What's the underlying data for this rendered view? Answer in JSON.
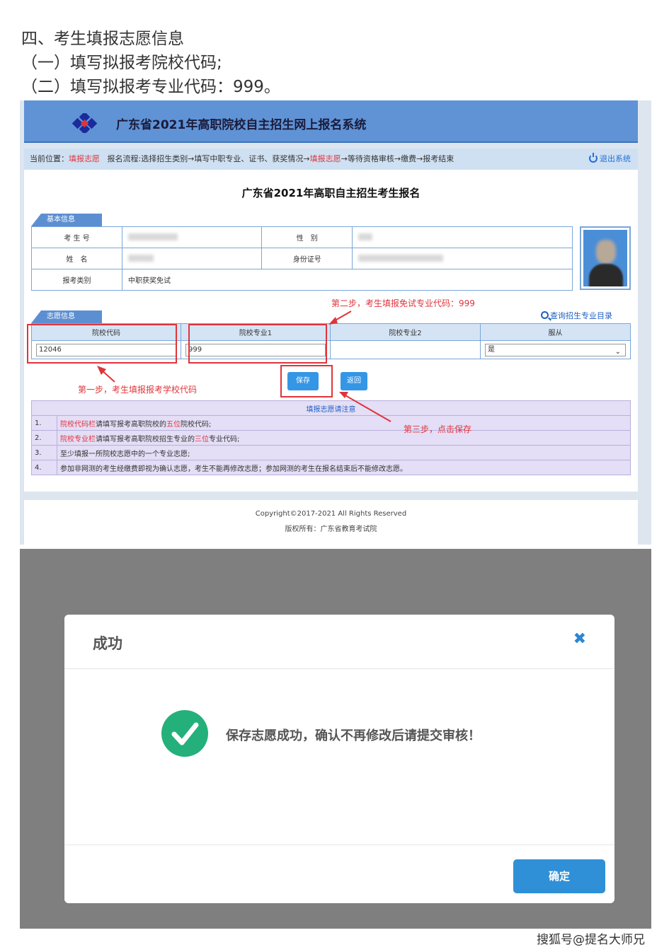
{
  "intro": {
    "heading": "四、考生填报志愿信息",
    "step1": "（一）填写拟报考院校代码;",
    "step2": "（二）填写拟报考专业代码：999。"
  },
  "app": {
    "title": "广东省2021年高职院校自主招生网上报名系统",
    "brand_colors": {
      "banner": "#5f93d6",
      "crumb": "#cfe0f2",
      "accent_red": "#e0343b",
      "button_blue": "#3596e6"
    }
  },
  "breadcrumb": {
    "current_label": "当前位置：",
    "current_page": "填报志愿",
    "flow_label": "报名流程:",
    "flow_steps_before": "选择招生类别→填写中职专业、证书、获奖情况→",
    "flow_current": "填报志愿",
    "flow_steps_after": "→等待资格审核→缴费→报考结束",
    "logout": "退出系统"
  },
  "form": {
    "title": "广东省2021年高职自主招生考生报名",
    "basic_section": "基本信息",
    "labels": {
      "exam_no": "考 生 号",
      "gender": "性　别",
      "name": "姓　名",
      "id_no": "身份证号",
      "category": "报考类别"
    },
    "category_value": "中职获奖免试",
    "wish_section": "志愿信息",
    "query_link": "查询招生专业目录",
    "columns": [
      "院校代码",
      "院校专业1",
      "院校专业2",
      "服从"
    ],
    "school_code": "12046",
    "major1": "999",
    "major2": "",
    "obey": "是",
    "save": "保存",
    "back": "返回"
  },
  "notes": {
    "head": "填报志愿请注意",
    "rows": [
      {
        "num": "1.",
        "red1": "院校代码栏",
        "mid": "请填写报考高职院校的",
        "red2": "五位",
        "tail": "院校代码;"
      },
      {
        "num": "2.",
        "red1": "院校专业栏",
        "mid": "请填写报考高职院校招生专业的",
        "red2": "三位",
        "tail": "专业代码;"
      },
      {
        "num": "3.",
        "red1": "",
        "mid": "至少填报一所院校志愿中的一个专业志愿;",
        "red2": "",
        "tail": ""
      },
      {
        "num": "4.",
        "red1": "",
        "mid": "参加非网测的考生经缴费即视为确认志愿，考生不能再修改志愿；参加网测的考生在报名结束后不能修改志愿。",
        "red2": "",
        "tail": ""
      }
    ]
  },
  "annotations": {
    "step1": "第一步，考生填报报考学校代码",
    "step2": "第二步，考生填报免试专业代码：999",
    "step3": "第三步，点击保存"
  },
  "footer": {
    "copyright": "Copyright©2017-2021   All  Rights  Reserved",
    "owner": "版权所有：广东省教育考试院"
  },
  "dialog": {
    "title": "成功",
    "message": "保存志愿成功，确认不再修改后请提交审核！",
    "ok": "确定"
  },
  "watermark": "搜狐号@提名大师兄"
}
